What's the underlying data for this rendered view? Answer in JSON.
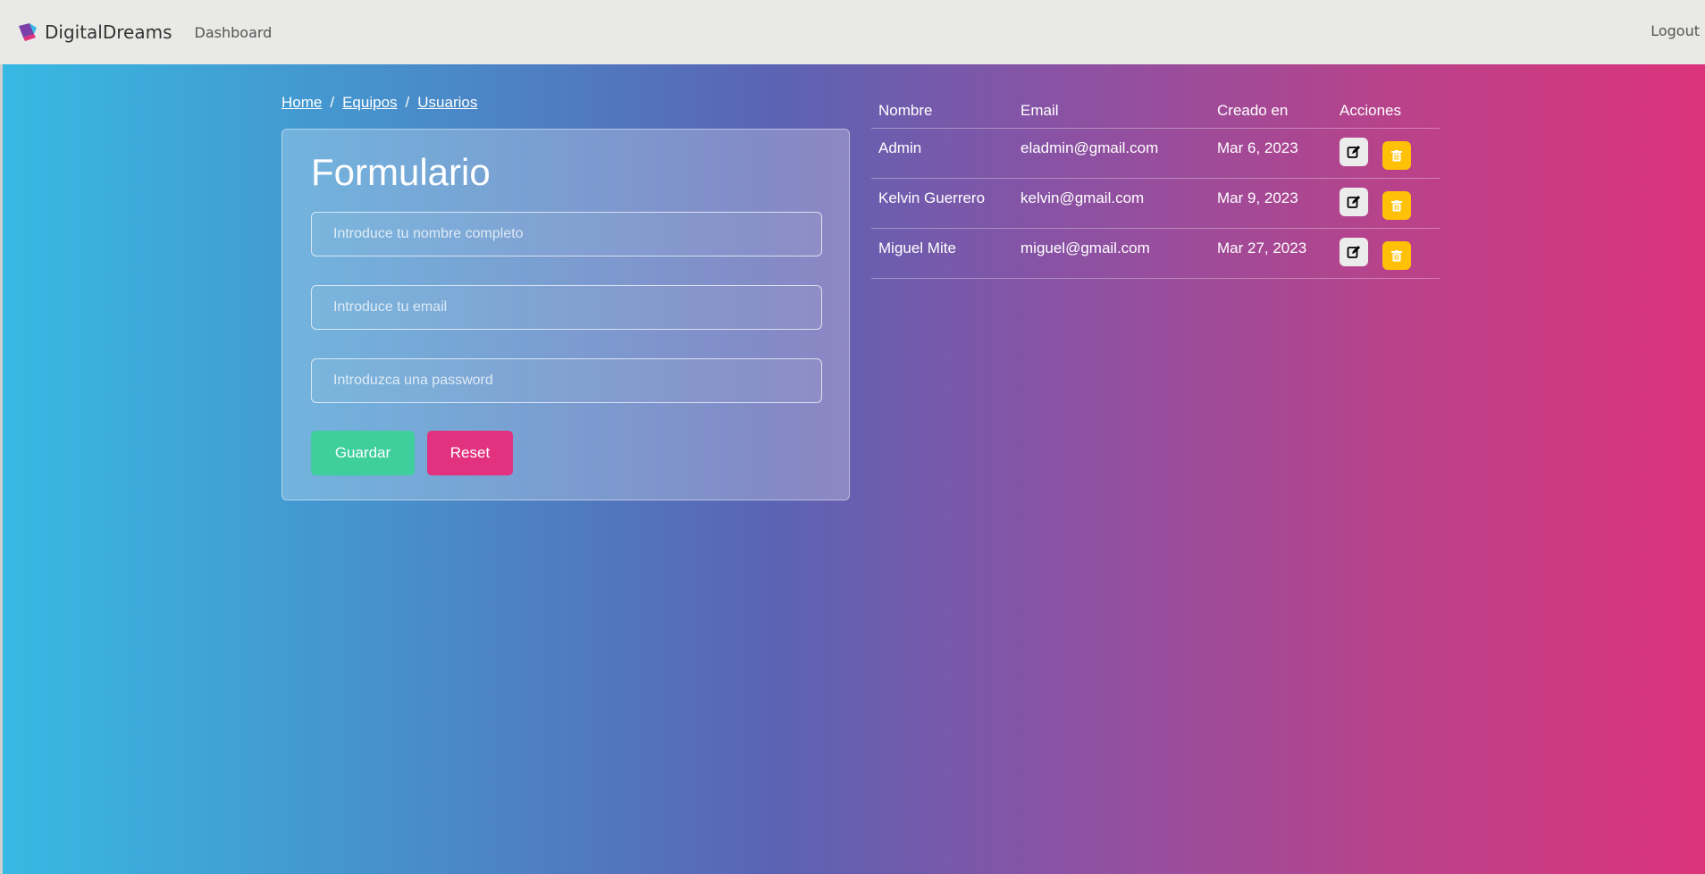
{
  "navbar": {
    "brand": "DigitalDreams",
    "links": [
      "Dashboard"
    ],
    "logout": "Logout"
  },
  "breadcrumb": {
    "items": [
      "Home",
      "Equipos",
      "Usuarios"
    ],
    "separator": "/"
  },
  "form": {
    "title": "Formulario",
    "fields": {
      "name_placeholder": "Introduce tu nombre completo",
      "email_placeholder": "Introduce tu email",
      "password_placeholder": "Introduzca una password"
    },
    "save_label": "Guardar",
    "reset_label": "Reset"
  },
  "table": {
    "headers": [
      "Nombre",
      "Email",
      "Creado en",
      "Acciones"
    ],
    "rows": [
      {
        "name": "Admin",
        "email": "eladmin@gmail.com",
        "created": "Mar 6, 2023"
      },
      {
        "name": "Kelvin Guerrero",
        "email": "kelvin@gmail.com",
        "created": "Mar 9, 2023"
      },
      {
        "name": "Miguel Mite",
        "email": "miguel@gmail.com",
        "created": "Mar 27, 2023"
      }
    ],
    "action_icons": [
      "edit-icon",
      "trash-icon"
    ]
  },
  "colors": {
    "gradient": [
      "#37b9e4",
      "#5a64b4",
      "#dc337c"
    ],
    "save": "#3ecf9c",
    "reset": "#e2327f",
    "delete": "#ffc107",
    "edit": "#ececec"
  }
}
